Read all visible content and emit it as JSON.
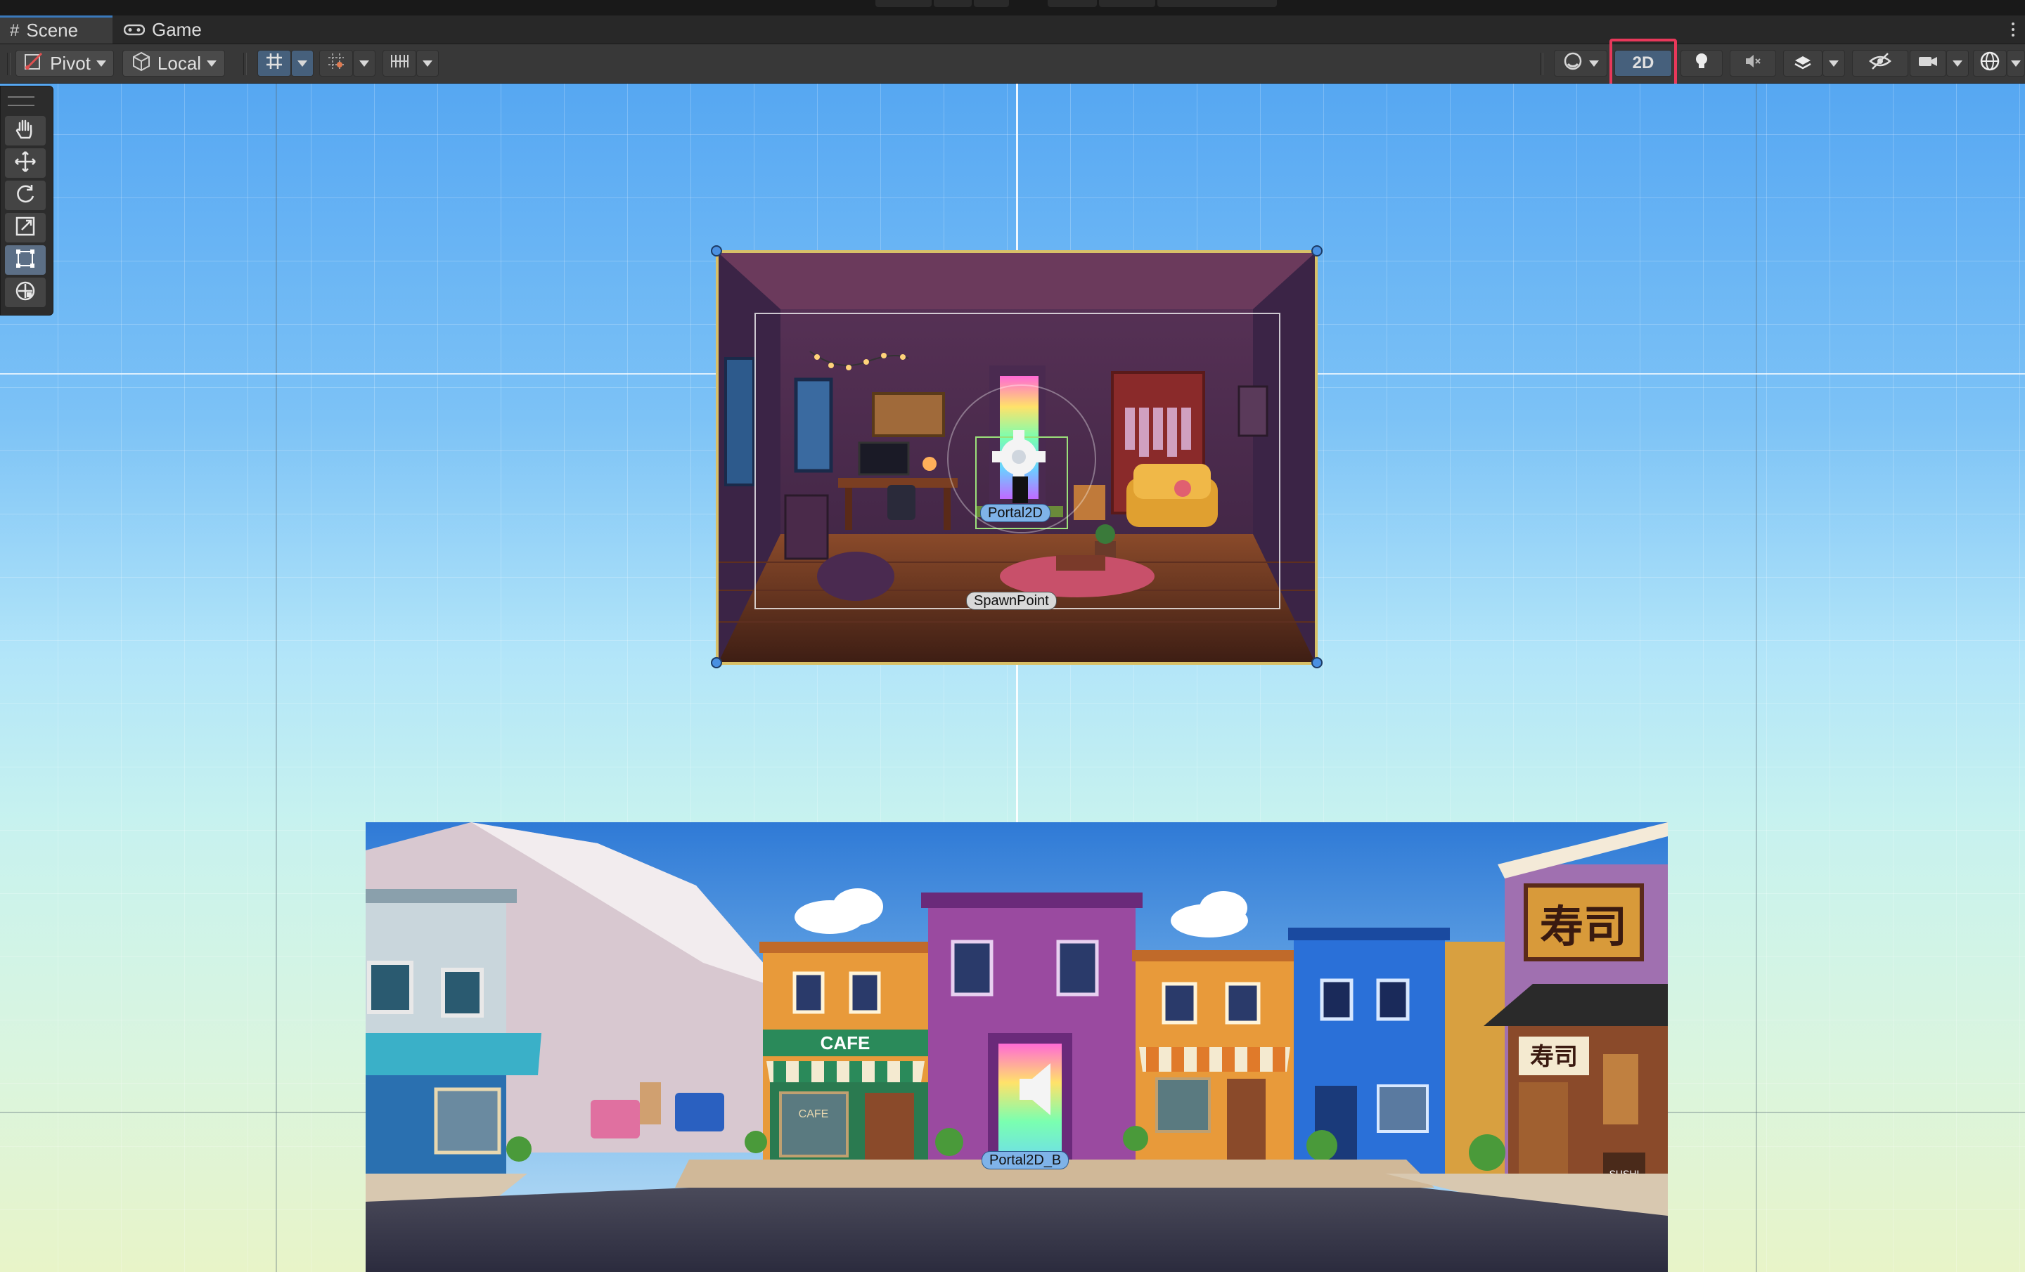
{
  "tabs": [
    {
      "label": "Scene",
      "icon": "grid-icon",
      "active": true
    },
    {
      "label": "Game",
      "icon": "gamepad-icon",
      "active": false
    }
  ],
  "toolbar": {
    "pivot_label": "Pivot",
    "local_label": "Local",
    "two_d_label": "2D",
    "two_d_active": true,
    "highlighted": "2D"
  },
  "tools": [
    {
      "name": "hand-tool",
      "icon": "hand-icon"
    },
    {
      "name": "move-tool",
      "icon": "move-icon"
    },
    {
      "name": "rotate-tool",
      "icon": "rotate-icon"
    },
    {
      "name": "scale-tool",
      "icon": "scale-icon"
    },
    {
      "name": "rect-tool",
      "icon": "rect-transform-icon",
      "selected": true
    },
    {
      "name": "transform-tool",
      "icon": "transform-icon"
    }
  ],
  "scene": {
    "labels": {
      "portal_a": "Portal2D",
      "spawn": "SpawnPoint",
      "portal_b": "Portal2D_B"
    },
    "signs": {
      "cafe": "CAFE",
      "sushi_big": "寿司",
      "sushi_small": "寿司",
      "sushi_board": "SUSHI",
      "cafe_window": "CAFE"
    }
  },
  "colors": {
    "accent": "#3a79bb",
    "highlight": "#e8385a",
    "sky_top": "#56a7f2",
    "sky_bottom": "#e8f4c8"
  }
}
